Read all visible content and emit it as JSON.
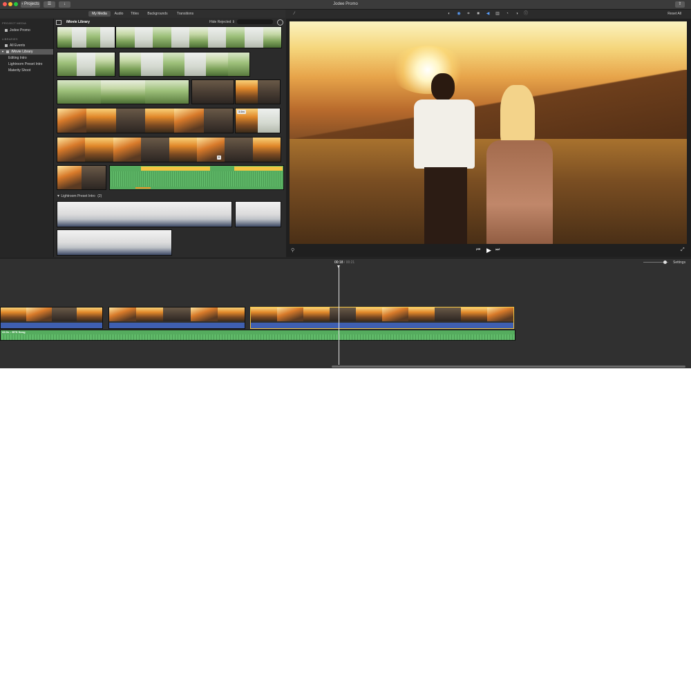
{
  "app": {
    "title": "Jodee Promo",
    "projects_label": "Projects"
  },
  "colors": {
    "accent": "#f5c542",
    "audio_green": "#55ac5e",
    "audio_blue": "#3f5fb0",
    "selection": "#5a5a5a"
  },
  "browser_tabs": [
    {
      "label": "My Media",
      "active": true
    },
    {
      "label": "Audio",
      "active": false
    },
    {
      "label": "Titles",
      "active": false
    },
    {
      "label": "Backgrounds",
      "active": false
    },
    {
      "label": "Transitions",
      "active": false
    }
  ],
  "sidebar": {
    "project_media_heading": "PROJECT MEDIA",
    "project_item": "Jodee Promo",
    "libraries_heading": "LIBRARIES",
    "items": [
      {
        "label": "All Events"
      },
      {
        "label": "iMovie Library"
      },
      {
        "label": "Editing Intro"
      },
      {
        "label": "Lightroom Preset Intro"
      },
      {
        "label": "Materity Shoot"
      }
    ]
  },
  "media_browser": {
    "title": "iMovie Library",
    "filter_label": "Hide Rejected",
    "section_title": "Lightroom Preset Intro",
    "section_count": "(2)",
    "duration_badge": "3.6m",
    "add_badge": "+"
  },
  "viewer_toolbar": {
    "reset_label": "Reset All",
    "icons": [
      "color-balance-icon",
      "color-correction-icon",
      "crop-icon",
      "stabilization-icon",
      "volume-icon",
      "equalizer-icon",
      "speed-icon",
      "noise-reduction-icon",
      "info-icon"
    ]
  },
  "timeline": {
    "current_time": "00:18",
    "separator": "/",
    "total_time": "00:21",
    "settings_label": "Settings",
    "audio_track_label": "22.0s – BTS Song"
  }
}
